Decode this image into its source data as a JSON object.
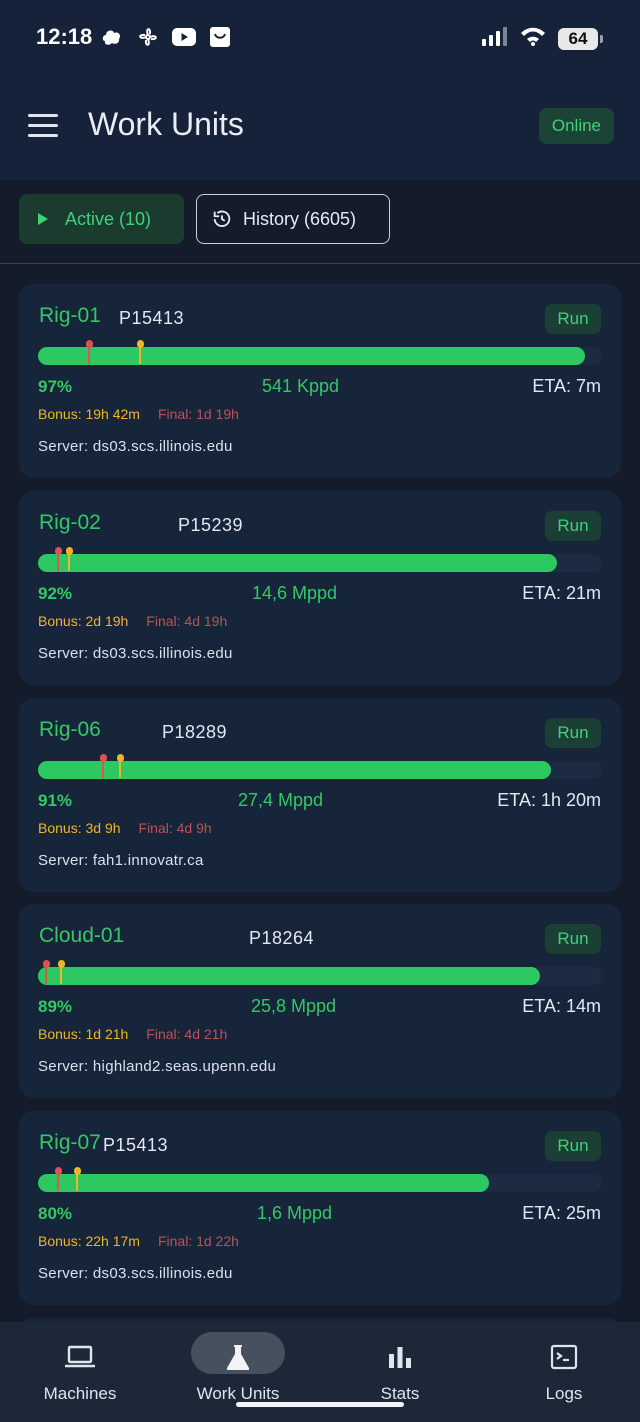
{
  "status_bar": {
    "time": "12:18",
    "battery": "64",
    "app_icons": [
      "cloud-app-icon",
      "pinwheel-app-icon",
      "youtube-icon",
      "shopping-bag-icon"
    ],
    "system_icons": [
      "cellular-signal-icon",
      "wifi-icon",
      "battery-icon"
    ]
  },
  "app_bar": {
    "menu_icon": "hamburger-menu-icon",
    "title": "Work Units",
    "status": "Online"
  },
  "tabs": {
    "active_label": "Active (10)",
    "active_icon": "play-icon",
    "history_label": "History (6605)",
    "history_icon": "history-icon"
  },
  "work_units": [
    {
      "machine": "Rig-01",
      "project": "P15413",
      "state": "Run",
      "percent": "97%",
      "progress": 0.97,
      "final_marker": 0.09,
      "bonus_marker": 0.18,
      "ppd": "541 Kppd",
      "eta": "ETA: 7m",
      "bonus": "Bonus: 19h 42m",
      "final": "Final: 1d 19h",
      "server": "Server: ds03.scs.illinois.edu"
    },
    {
      "machine": "Rig-02",
      "project": "P15239",
      "state": "Run",
      "percent": "92%",
      "progress": 0.92,
      "final_marker": 0.035,
      "bonus_marker": 0.055,
      "ppd": "14,6 Mppd",
      "eta": "ETA: 21m",
      "bonus": "Bonus: 2d 19h",
      "final": "Final: 4d 19h",
      "server": "Server: ds03.scs.illinois.edu"
    },
    {
      "machine": "Rig-06",
      "project": "P18289",
      "state": "Run",
      "percent": "91%",
      "progress": 0.91,
      "final_marker": 0.115,
      "bonus_marker": 0.145,
      "ppd": "27,4 Mppd",
      "eta": "ETA: 1h 20m",
      "bonus": "Bonus: 3d 9h",
      "final": "Final: 4d 9h",
      "server": "Server: fah1.innovatr.ca"
    },
    {
      "machine": "Cloud-01",
      "project": "P18264",
      "state": "Run",
      "percent": "89%",
      "progress": 0.89,
      "final_marker": 0.015,
      "bonus_marker": 0.04,
      "ppd": "25,8 Mppd",
      "eta": "ETA: 14m",
      "bonus": "Bonus: 1d 21h",
      "final": "Final: 4d 21h",
      "server": "Server: highland2.seas.upenn.edu"
    },
    {
      "machine": "Rig-07",
      "project": "P15413",
      "state": "Run",
      "percent": "80%",
      "progress": 0.8,
      "final_marker": 0.035,
      "bonus_marker": 0.07,
      "ppd": "1,6 Mppd",
      "eta": "ETA: 25m",
      "bonus": "Bonus: 22h 17m",
      "final": "Final: 1d 22h",
      "server": "Server: ds03.scs.illinois.edu"
    }
  ],
  "bottom_nav": {
    "items": [
      {
        "label": "Machines",
        "icon": "laptop-icon",
        "active": false
      },
      {
        "label": "Work Units",
        "icon": "flask-icon",
        "active": true
      },
      {
        "label": "Stats",
        "icon": "bar-chart-icon",
        "active": false
      },
      {
        "label": "Logs",
        "icon": "terminal-icon",
        "active": false
      }
    ]
  },
  "colors": {
    "background": "#141b2a",
    "header": "#16213a",
    "card": "#17253b",
    "accent_green": "#2ec862",
    "final_marker": "#e05252",
    "bonus_marker": "#f0b429"
  }
}
